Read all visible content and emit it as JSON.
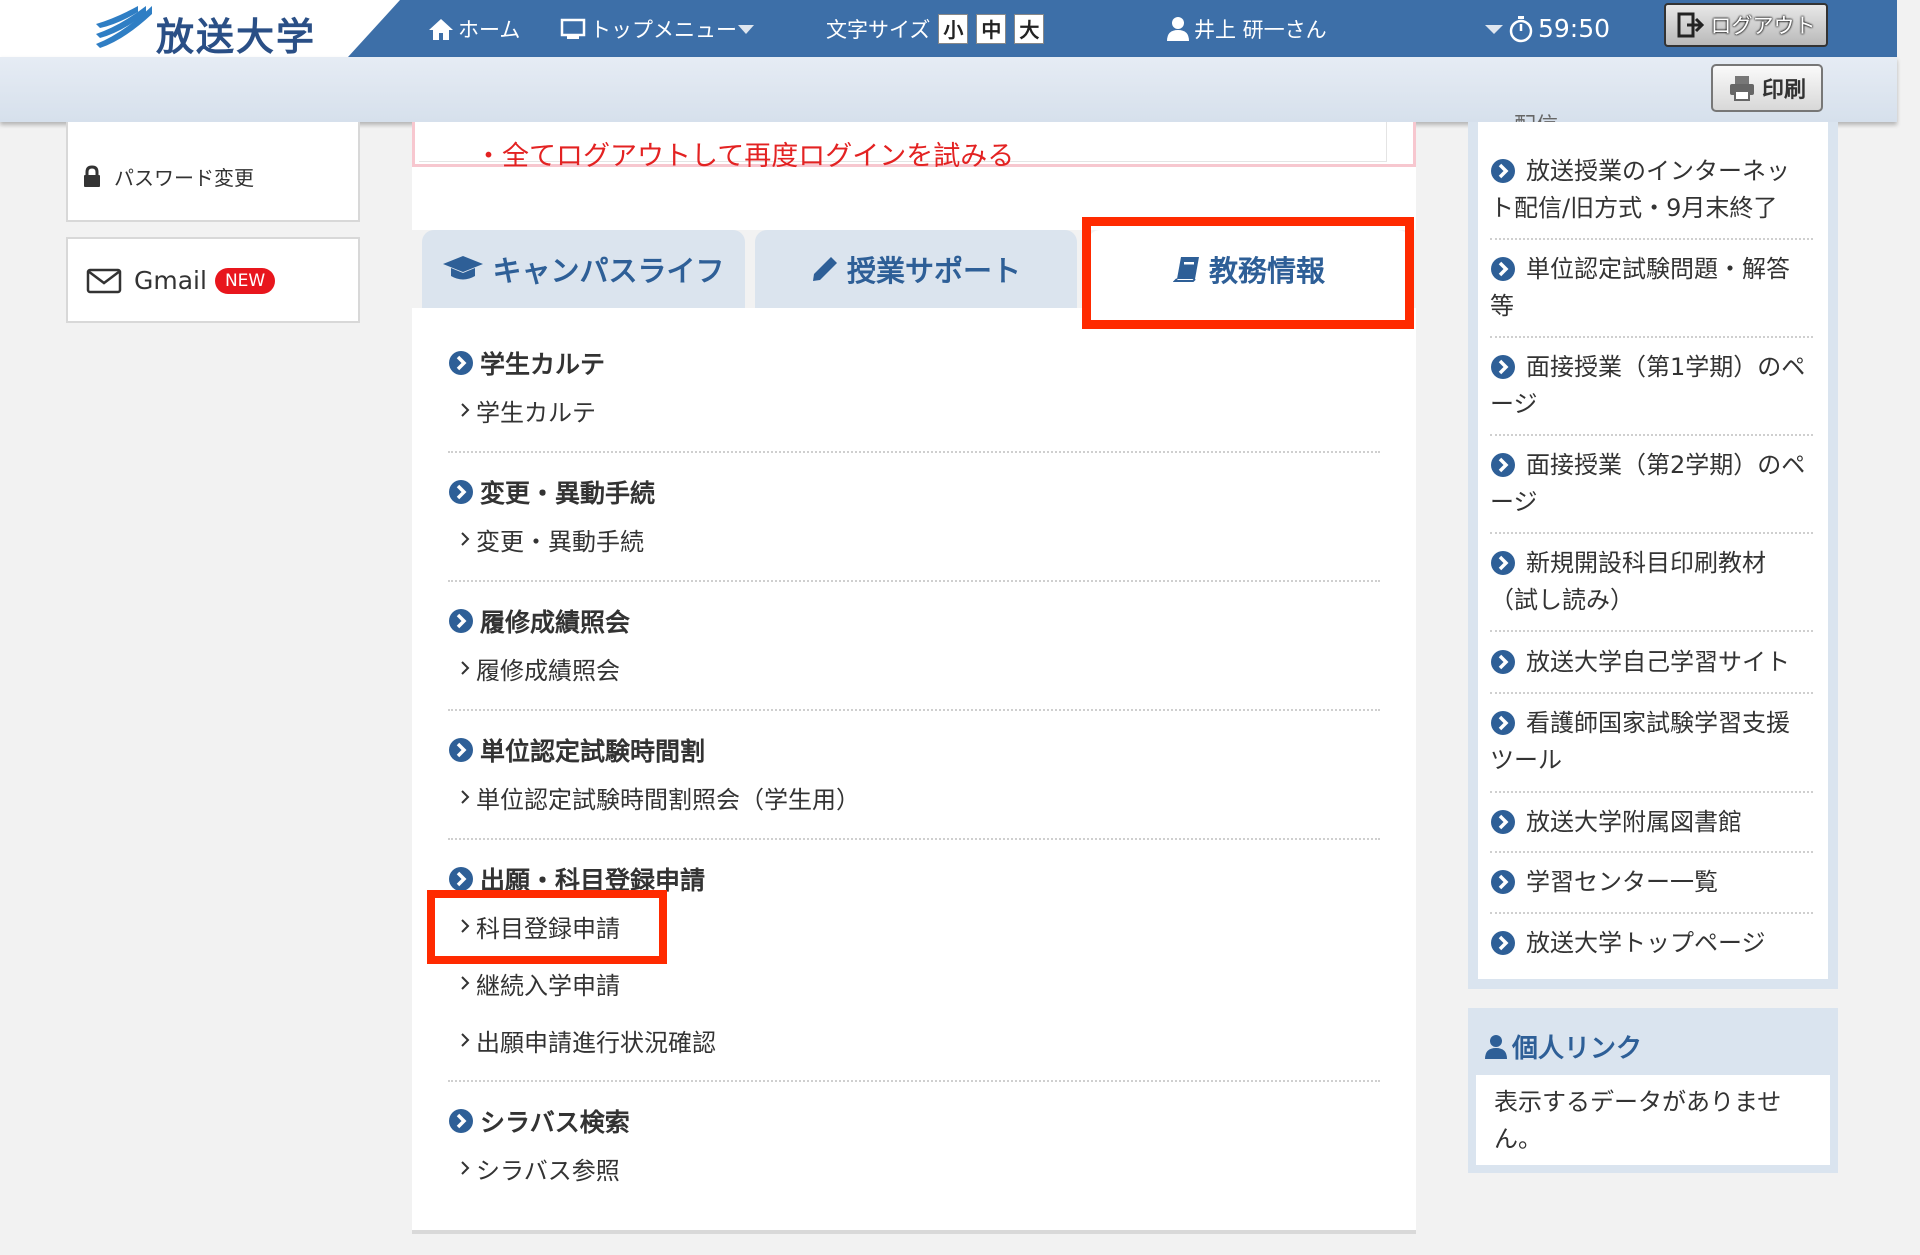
{
  "header": {
    "logo_text": "放送大学",
    "home_label": "ホーム",
    "topmenu_label": "トップメニュー",
    "font_size_label": "文字サイズ",
    "font_sizes": [
      "小",
      "中",
      "大"
    ],
    "user_name": "井上 研一さん",
    "timer": "59:50",
    "logout_label": "ログアウト",
    "print_label": "印刷"
  },
  "left_sidebar": {
    "password_label": "パスワード変更",
    "gmail_label": "Gmail",
    "new_badge": "NEW"
  },
  "notice": {
    "text": "・全てログアウトして再度ログインを試みる"
  },
  "tabs": [
    {
      "label": "キャンパスライフ",
      "icon": "graduation-cap-icon"
    },
    {
      "label": "授業サポート",
      "icon": "pencil-icon"
    },
    {
      "label": "教務情報",
      "icon": "book-icon",
      "active": true
    }
  ],
  "sections": [
    {
      "title": "学生カルテ",
      "links": [
        "学生カルテ"
      ]
    },
    {
      "title": "変更・異動手続",
      "links": [
        "変更・異動手続"
      ]
    },
    {
      "title": "履修成績照会",
      "links": [
        "履修成績照会"
      ]
    },
    {
      "title": "単位認定試験時間割",
      "links": [
        "単位認定試験時間割照会（学生用）"
      ]
    },
    {
      "title": "出願・科目登録申請",
      "links": [
        "科目登録申請",
        "継続入学申請",
        "出願申請進行状況確認"
      ]
    },
    {
      "title": "シラバス検索",
      "links": [
        "シラバス参照"
      ]
    }
  ],
  "right_sidebar": {
    "partial_top": "ー配信",
    "items": [
      "放送授業のインターネット配信/旧方式・9月末終了",
      "単位認定試験問題・解答等",
      "面接授業（第1学期）のページ",
      "面接授業（第2学期）のページ",
      "新規開設科目印刷教材（試し読み）",
      "放送大学自己学習サイト",
      "看護師国家試験学習支援ツール",
      "放送大学附属図書館",
      "学習センター一覧",
      "放送大学トップページ"
    ],
    "personal_title": "個人リンク",
    "personal_empty": "表示するデータがありません。"
  },
  "colors": {
    "header_blue": "#3d6fa8",
    "tab_text": "#2e5f97",
    "highlight_red": "#ff2a00",
    "notice_red": "#e32222",
    "badge_red": "#e8161d"
  }
}
